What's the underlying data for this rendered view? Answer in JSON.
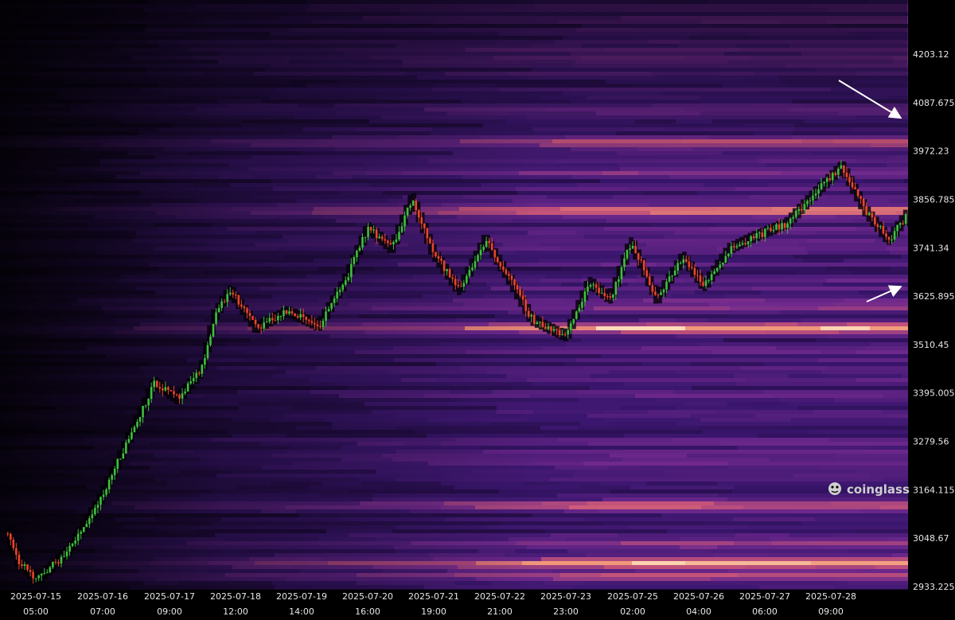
{
  "chart_data": {
    "type": "heatmap",
    "title": "",
    "xlabel": "",
    "ylabel": "",
    "ylim": [
      2900,
      4280
    ],
    "y_ticks": [
      "4203.12",
      "4087.675",
      "3972.23",
      "3856.785",
      "3741.34",
      "3625.895",
      "3510.45",
      "3395.005",
      "3279.56",
      "3164.115",
      "3048.67",
      "2933.225"
    ],
    "x_ticks": [
      {
        "date": "2025-07-15",
        "time": "05:00"
      },
      {
        "date": "2025-07-16",
        "time": "07:00"
      },
      {
        "date": "2025-07-17",
        "time": "09:00"
      },
      {
        "date": "2025-07-18",
        "time": "12:00"
      },
      {
        "date": "2025-07-19",
        "time": "14:00"
      },
      {
        "date": "2025-07-20",
        "time": "16:00"
      },
      {
        "date": "2025-07-21",
        "time": "19:00"
      },
      {
        "date": "2025-07-22",
        "time": "21:00"
      },
      {
        "date": "2025-07-23",
        "time": "23:00"
      },
      {
        "date": "2025-07-25",
        "time": "02:00"
      },
      {
        "date": "2025-07-26",
        "time": "04:00"
      },
      {
        "date": "2025-07-27",
        "time": "06:00"
      },
      {
        "date": "2025-07-28",
        "time": "09:00"
      }
    ],
    "price_path": [
      [
        "2025-07-15 00:00",
        3060
      ],
      [
        "2025-07-15 05:00",
        2990
      ],
      [
        "2025-07-15 12:00",
        2950
      ],
      [
        "2025-07-16 00:00",
        3020
      ],
      [
        "2025-07-16 12:00",
        3140
      ],
      [
        "2025-07-17 00:00",
        3300
      ],
      [
        "2025-07-17 09:00",
        3420
      ],
      [
        "2025-07-17 18:00",
        3380
      ],
      [
        "2025-07-18 03:00",
        3450
      ],
      [
        "2025-07-18 08:00",
        3580
      ],
      [
        "2025-07-18 14:00",
        3640
      ],
      [
        "2025-07-19 00:00",
        3550
      ],
      [
        "2025-07-19 12:00",
        3590
      ],
      [
        "2025-07-20 00:00",
        3555
      ],
      [
        "2025-07-20 10:00",
        3660
      ],
      [
        "2025-07-20 19:00",
        3790
      ],
      [
        "2025-07-21 04:00",
        3740
      ],
      [
        "2025-07-21 12:00",
        3860
      ],
      [
        "2025-07-21 20:00",
        3730
      ],
      [
        "2025-07-22 06:00",
        3640
      ],
      [
        "2025-07-22 16:00",
        3760
      ],
      [
        "2025-07-23 01:00",
        3670
      ],
      [
        "2025-07-23 10:00",
        3570
      ],
      [
        "2025-07-23 23:00",
        3530
      ],
      [
        "2025-07-24 08:00",
        3660
      ],
      [
        "2025-07-24 16:00",
        3620
      ],
      [
        "2025-07-25 00:00",
        3755
      ],
      [
        "2025-07-25 10:00",
        3620
      ],
      [
        "2025-07-25 20:00",
        3720
      ],
      [
        "2025-07-26 04:00",
        3650
      ],
      [
        "2025-07-26 14:00",
        3740
      ],
      [
        "2025-07-27 00:00",
        3770
      ],
      [
        "2025-07-27 12:00",
        3800
      ],
      [
        "2025-07-28 00:00",
        3880
      ],
      [
        "2025-07-28 09:00",
        3935
      ],
      [
        "2025-07-28 18:00",
        3830
      ],
      [
        "2025-07-29 03:00",
        3760
      ],
      [
        "2025-07-29 10:00",
        3820
      ]
    ],
    "liquidity_bands": [
      {
        "price": 3950,
        "intensity": 0.85
      },
      {
        "price": 3880,
        "intensity": 0.6
      },
      {
        "price": 3790,
        "intensity": 0.95
      },
      {
        "price": 3700,
        "intensity": 0.5
      },
      {
        "price": 3565,
        "intensity": 0.65
      },
      {
        "price": 3515,
        "intensity": 1.0
      },
      {
        "price": 3100,
        "intensity": 0.85
      },
      {
        "price": 3010,
        "intensity": 0.7
      },
      {
        "price": 2965,
        "intensity": 1.0
      },
      {
        "price": 2935,
        "intensity": 0.8
      }
    ],
    "colors": {
      "background": "#000000",
      "up": "#3fbf3f",
      "down": "#e8462a",
      "heat_low": "#4a1d8a",
      "heat_high": "#ffd9b0"
    }
  },
  "watermark": {
    "text": "coinglass",
    "icon": "coinglass-logo-icon"
  },
  "annotations": [
    {
      "kind": "arrow",
      "points_to": "3995"
    },
    {
      "kind": "arrow",
      "points_to": "3660"
    }
  ]
}
